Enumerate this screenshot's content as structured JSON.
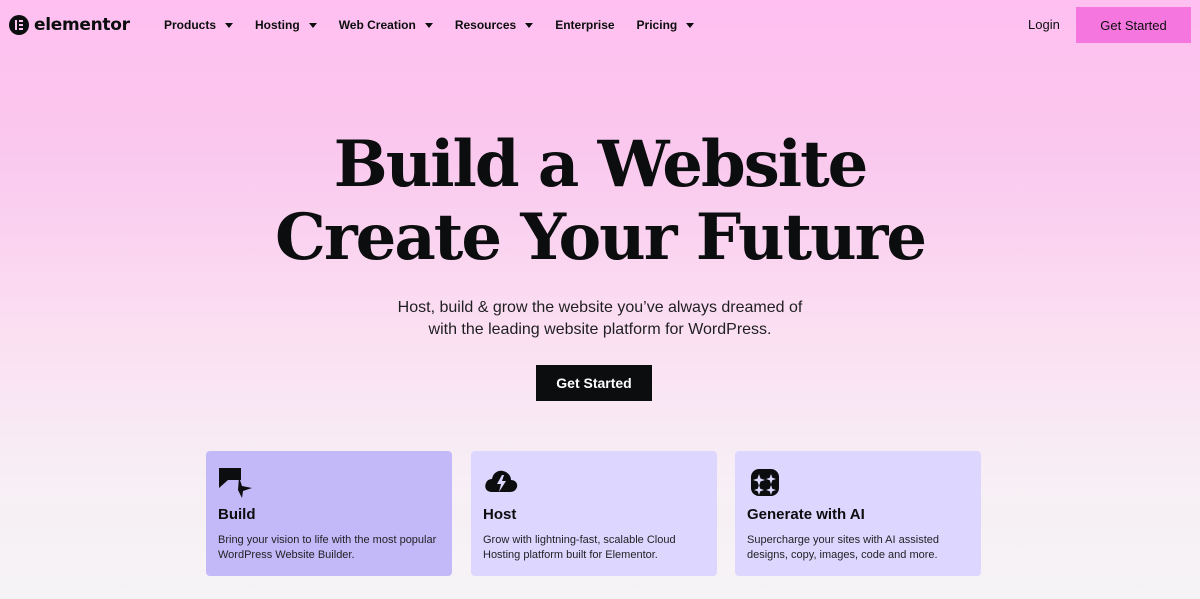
{
  "brand": {
    "name": "elementor",
    "logo_icon": "elementor-logo-icon"
  },
  "nav": {
    "items": [
      {
        "label": "Products",
        "has_dropdown": true
      },
      {
        "label": "Hosting",
        "has_dropdown": true
      },
      {
        "label": "Web Creation",
        "has_dropdown": true
      },
      {
        "label": "Resources",
        "has_dropdown": true
      },
      {
        "label": "Enterprise",
        "has_dropdown": false
      },
      {
        "label": "Pricing",
        "has_dropdown": true
      }
    ],
    "login_label": "Login",
    "cta_label": "Get Started"
  },
  "hero": {
    "title_line1": "Build a Website",
    "title_line2": "Create Your Future",
    "subtitle_line1": "Host, build & grow the website you’ve always dreamed of",
    "subtitle_line2": "with the leading website platform for WordPress.",
    "cta_label": "Get Started"
  },
  "cards": [
    {
      "icon": "build-icon",
      "title": "Build",
      "description": "Bring your vision to life with the most popular WordPress Website Builder."
    },
    {
      "icon": "cloud-bolt-icon",
      "title": "Host",
      "description": "Grow with lightning-fast, scalable Cloud Hosting platform built for Elementor."
    },
    {
      "icon": "ai-sparkle-icon",
      "title": "Generate with AI",
      "description": "Supercharge your sites with AI assisted designs, copy, images, code and more."
    }
  ],
  "colors": {
    "accent_pink": "#f676e0",
    "text_dark": "#0c0d0e",
    "card_build": "#c3b8f8",
    "card_default": "#ddd6fe"
  }
}
